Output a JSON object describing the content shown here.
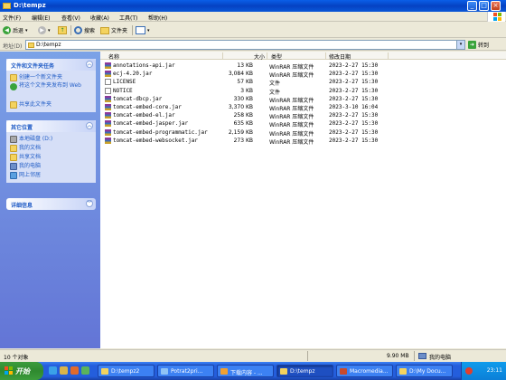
{
  "window": {
    "title": "D:\\tempz",
    "btn_min": "_",
    "btn_max": "□",
    "btn_close": "×"
  },
  "menu": [
    "文件(F)",
    "编辑(E)",
    "查看(V)",
    "收藏(A)",
    "工具(T)",
    "帮助(H)"
  ],
  "toolbar": {
    "back": "后退",
    "search": "搜索",
    "folders": "文件夹",
    "views_icon": "views-icon"
  },
  "address": {
    "label": "地址(D)",
    "value": "D:\\tempz",
    "go": "转到"
  },
  "leftpane": {
    "tasks_title": "文件和文件夹任务",
    "tasks": [
      "创建一个新文件夹",
      "将这个文件夹发布到 Web",
      "共享此文件夹"
    ],
    "places_title": "其它位置",
    "places": [
      "本地磁盘 (D:)",
      "我的文档",
      "共享文档",
      "我的电脑",
      "网上邻居"
    ],
    "details_title": "详细信息"
  },
  "columns": {
    "name": "名称",
    "size": "大小",
    "type": "类型",
    "modified": "修改日期"
  },
  "files": [
    {
      "name": "annotations-api.jar",
      "size": "13 KB",
      "type": "WinRAR 压缩文件",
      "date": "2023-2-27 15:30",
      "icon": "rar-icon"
    },
    {
      "name": "ecj-4.20.jar",
      "size": "3,084 KB",
      "type": "WinRAR 压缩文件",
      "date": "2023-2-27 15:30",
      "icon": "rar-icon"
    },
    {
      "name": "LICENSE",
      "size": "57 KB",
      "type": "文件",
      "date": "2023-2-27 15:30",
      "icon": "file-icon"
    },
    {
      "name": "NOTICE",
      "size": "3 KB",
      "type": "文件",
      "date": "2023-2-27 15:30",
      "icon": "file-icon"
    },
    {
      "name": "tomcat-dbcp.jar",
      "size": "330 KB",
      "type": "WinRAR 压缩文件",
      "date": "2023-2-27 15:30",
      "icon": "rar-icon"
    },
    {
      "name": "tomcat-embed-core.jar",
      "size": "3,370 KB",
      "type": "WinRAR 压缩文件",
      "date": "2023-3-10 16:04",
      "icon": "rar-icon"
    },
    {
      "name": "tomcat-embed-el.jar",
      "size": "258 KB",
      "type": "WinRAR 压缩文件",
      "date": "2023-2-27 15:30",
      "icon": "rar-icon"
    },
    {
      "name": "tomcat-embed-jasper.jar",
      "size": "635 KB",
      "type": "WinRAR 压缩文件",
      "date": "2023-2-27 15:30",
      "icon": "rar-icon"
    },
    {
      "name": "tomcat-embed-programmatic.jar",
      "size": "2,159 KB",
      "type": "WinRAR 压缩文件",
      "date": "2023-2-27 15:30",
      "icon": "rar-icon"
    },
    {
      "name": "tomcat-embed-websocket.jar",
      "size": "273 KB",
      "type": "WinRAR 压缩文件",
      "date": "2023-2-27 15:30",
      "icon": "rar-icon"
    }
  ],
  "status": {
    "count": "10 个对象",
    "size": "9.90 MB",
    "location": "我的电脑"
  },
  "taskbar": {
    "start": "开始",
    "tasks": [
      {
        "label": "D:\\tempz2",
        "icon": "folder-icon"
      },
      {
        "label": "Potrat2pri...",
        "icon": "app-icon"
      },
      {
        "label": "下载内容 - ...",
        "icon": "browser-icon"
      },
      {
        "label": "D:\\tempz",
        "icon": "folder-icon"
      },
      {
        "label": "Macromedia...",
        "icon": "app-icon"
      },
      {
        "label": "D:\\My Docu...",
        "icon": "folder-icon"
      }
    ],
    "clock": "23:11"
  }
}
